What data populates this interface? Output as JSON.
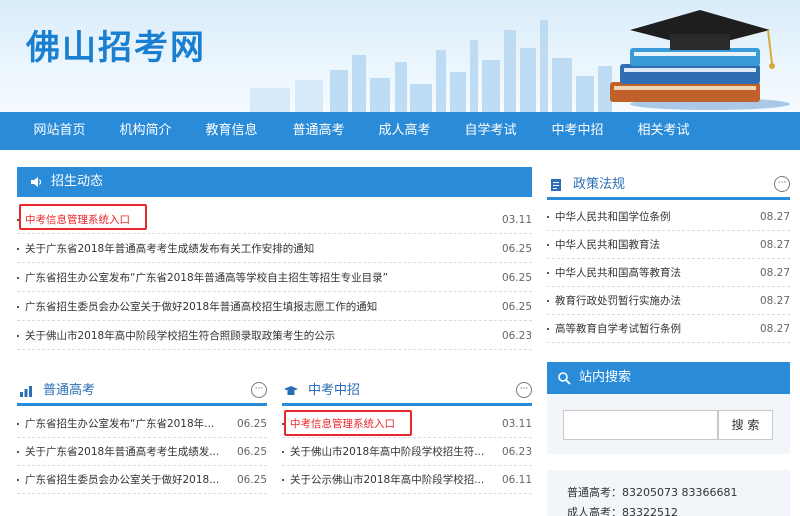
{
  "site": {
    "title": "佛山招考网"
  },
  "nav": [
    "网站首页",
    "机构简介",
    "教育信息",
    "普通高考",
    "成人高考",
    "自学考试",
    "中考中招",
    "相关考试"
  ],
  "zhaosheng": {
    "title": "招生动态",
    "items": [
      {
        "text": "中考信息管理系统入口",
        "date": "03.11"
      },
      {
        "text": "关于广东省2018年普通高考考生成绩发布有关工作安排的通知",
        "date": "06.25"
      },
      {
        "text": "广东省招生办公室发布“广东省2018年普通高等学校自主招生等招生专业目录”",
        "date": "06.25"
      },
      {
        "text": "广东省招生委员会办公室关于做好2018年普通高校招生填报志愿工作的通知",
        "date": "06.25"
      },
      {
        "text": "关于佛山市2018年高中阶段学校招生符合照顾录取政策考生的公示",
        "date": "06.23"
      }
    ]
  },
  "zhengce": {
    "title": "政策法规",
    "items": [
      {
        "text": "中华人民共和国学位条例",
        "date": "08.27"
      },
      {
        "text": "中华人民共和国教育法",
        "date": "08.27"
      },
      {
        "text": "中华人民共和国高等教育法",
        "date": "08.27"
      },
      {
        "text": "教育行政处罚暂行实施办法",
        "date": "08.27"
      },
      {
        "text": "高等教育自学考试暂行条例",
        "date": "08.27"
      }
    ]
  },
  "putong": {
    "title": "普通高考",
    "items": [
      {
        "text": "广东省招生办公室发布“广东省2018年...",
        "date": "06.25"
      },
      {
        "text": "关于广东省2018年普通高考考生成绩发...",
        "date": "06.25"
      },
      {
        "text": "广东省招生委员会办公室关于做好2018...",
        "date": "06.25"
      }
    ]
  },
  "zhongkao": {
    "title": "中考中招",
    "items": [
      {
        "text": "中考信息管理系统入口",
        "date": "03.11"
      },
      {
        "text": "关于佛山市2018年高中阶段学校招生符...",
        "date": "06.23"
      },
      {
        "text": "关于公示佛山市2018年高中阶段学校招...",
        "date": "06.11"
      }
    ]
  },
  "search": {
    "title": "站内搜索",
    "button": "搜 索",
    "placeholder": ""
  },
  "contact": {
    "line1": "普通高考：83205073 83366681",
    "line2": "成人高考：83322512"
  },
  "more": "···",
  "colors": {
    "primary": "#2a8bd8",
    "highlight": "#e8282a",
    "title": "#1a7fd0"
  }
}
